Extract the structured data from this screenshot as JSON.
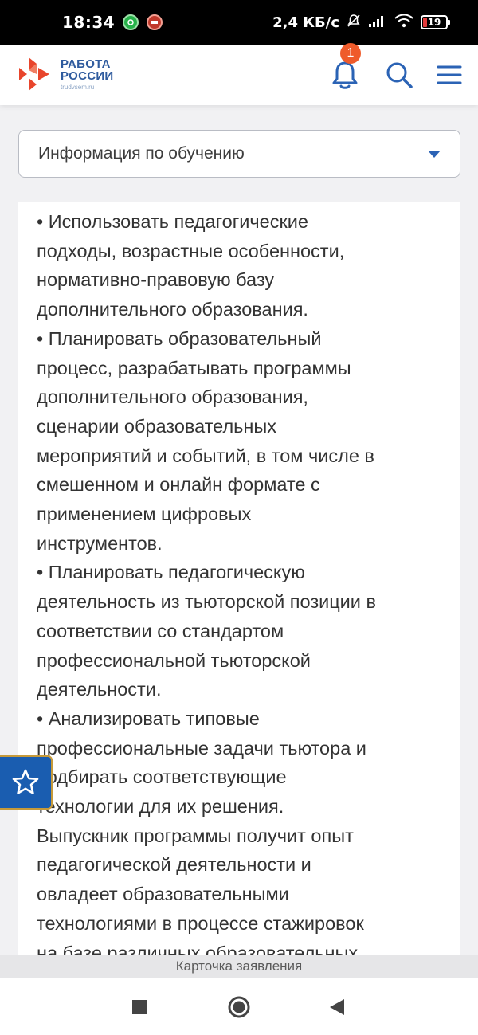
{
  "status_bar": {
    "time": "18:34",
    "speed": "2,4 КБ/с",
    "battery": "19",
    "app_icons": [
      "messenger-icon",
      "vk-app-icon"
    ]
  },
  "header": {
    "logo_line1": "РАБОТА",
    "logo_line2": "РОССИИ",
    "logo_sub": "trudvsem.ru",
    "notification_count": "1"
  },
  "dropdown": {
    "selected": "Информация по обучению"
  },
  "content": {
    "lines": [
      "• Использовать  педагогические",
      "подходы, возрастные особенности,",
      "нормативно-правовую базу",
      "дополнительного образования.",
      "• Планировать образовательный",
      "процесс, разрабатывать программы",
      "дополнительного образования,",
      "сценарии образовательных",
      "мероприятий и событий, в том числе в",
      "смешенном и онлайн формате с",
      "применением цифровых",
      "инструментов.",
      "• Планировать педагогическую",
      "деятельность из тьюторской позиции в",
      "соответствии со стандартом",
      "профессиональной тьюторской",
      "деятельности.",
      "• Анализировать типовые",
      "профессиональные задачи тьютора и",
      "подбирать соответствующие",
      "технологии для их решения.",
      "Выпускник программы получит опыт",
      "педагогической деятельности и",
      "овладеет образовательными",
      "технологиями в процессе стажировок",
      "на базе различных образовательных"
    ]
  },
  "bottom_strip": {
    "label": "Карточка заявления"
  },
  "colors": {
    "brand_blue": "#2f5b9e",
    "accent_blue": "#2b63b5",
    "badge_orange": "#ef5b2b",
    "logo_red": "#e8452c",
    "fab_blue": "#1a5db0"
  }
}
